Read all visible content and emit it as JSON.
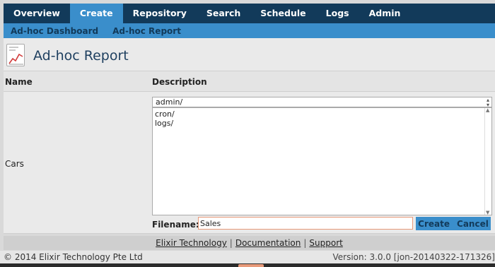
{
  "nav": {
    "items": [
      {
        "label": "Overview",
        "active": false
      },
      {
        "label": "Create",
        "active": true
      },
      {
        "label": "Repository",
        "active": false
      },
      {
        "label": "Search",
        "active": false
      },
      {
        "label": "Schedule",
        "active": false
      },
      {
        "label": "Logs",
        "active": false
      },
      {
        "label": "Admin",
        "active": false
      }
    ]
  },
  "subnav": {
    "items": [
      {
        "label": "Ad-hoc Dashboard"
      },
      {
        "label": "Ad-hoc Report"
      }
    ]
  },
  "page": {
    "title": "Ad-hoc Report",
    "icon": "report-chart-icon"
  },
  "table": {
    "headers": {
      "name": "Name",
      "description": "Description"
    },
    "row": {
      "name": "Cars"
    }
  },
  "folder_select": {
    "value": "admin/"
  },
  "file_list": {
    "items": [
      "cron/",
      "logs/"
    ]
  },
  "filename": {
    "label": "Filename:",
    "value": "Sales"
  },
  "actions": {
    "create": "Create",
    "cancel": "Cancel"
  },
  "footer": {
    "links": [
      "Elixir Technology",
      "Documentation",
      "Support"
    ],
    "separator": "|",
    "copyright": "© 2014 Elixir Technology Pte Ltd",
    "version": "Version: 3.0.0 [jon-20140322-171326]"
  },
  "colors": {
    "nav_bg": "#123a5a",
    "accent": "#3a8ecb",
    "input_focus_border": "#e89a7a"
  }
}
